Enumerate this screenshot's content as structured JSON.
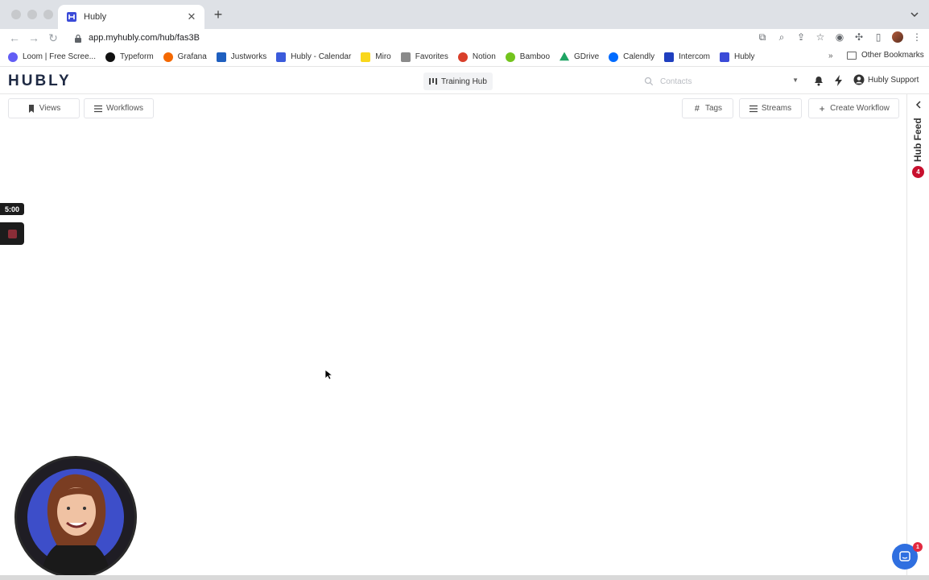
{
  "browser": {
    "tab_title": "Hubly",
    "url": "app.myhubly.com/hub/fas3B",
    "bookmarks": [
      {
        "label": "Loom | Free Scree...",
        "icon": "loom-icon",
        "color": "#625df5"
      },
      {
        "label": "Typeform",
        "icon": "typeform-icon",
        "color": "#111111"
      },
      {
        "label": "Grafana",
        "icon": "grafana-icon",
        "color": "#f46800"
      },
      {
        "label": "Justworks",
        "icon": "justworks-icon",
        "color": "#1f5fbf"
      },
      {
        "label": "Hubly - Calendar",
        "icon": "calendar-icon",
        "color": "#3b5bdb"
      },
      {
        "label": "Miro",
        "icon": "miro-icon",
        "color": "#f9d71c"
      },
      {
        "label": "Favorites",
        "icon": "folder-icon",
        "color": "#6b6b6b"
      },
      {
        "label": "Notion",
        "icon": "notion-icon",
        "color": "#d93f2a"
      },
      {
        "label": "Bamboo",
        "icon": "bamboo-icon",
        "color": "#73c41d"
      },
      {
        "label": "GDrive",
        "icon": "gdrive-icon",
        "color": "#1fa463"
      },
      {
        "label": "Calendly",
        "icon": "calendly-icon",
        "color": "#006bff"
      },
      {
        "label": "Intercom",
        "icon": "intercom-icon",
        "color": "#1f3fbf"
      },
      {
        "label": "Hubly",
        "icon": "hubly-icon",
        "color": "#3b4bd8"
      }
    ],
    "more_bookmarks": "»",
    "other_bookmarks": "Other Bookmarks"
  },
  "app": {
    "logo": "HUBLY",
    "training_hub": "Training Hub",
    "search_placeholder": "Contacts",
    "support_user": "Hubly Support",
    "buttons": {
      "views": "Views",
      "workflows": "Workflows",
      "tags": "Tags",
      "streams": "Streams",
      "create_workflow": "Create Workflow"
    },
    "feed": {
      "label": "Hub Feed",
      "count": "4"
    }
  },
  "recorder": {
    "timer": "5:00"
  },
  "chat": {
    "badge": "1"
  },
  "colors": {
    "brand": "#1f2a44",
    "accent_blue": "#2f6fe0",
    "alert_red": "#c8102e"
  }
}
